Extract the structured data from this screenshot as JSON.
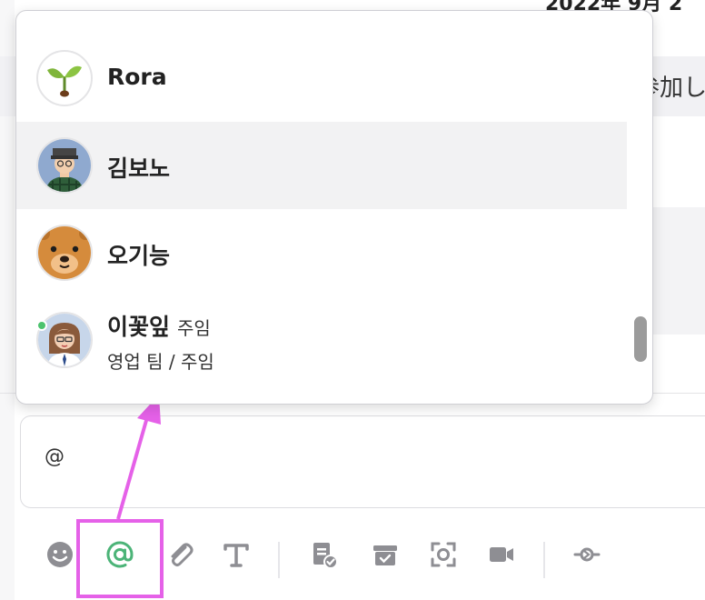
{
  "background": {
    "date_header": "2022年 9月 2",
    "band_text": "参加し",
    "accent_color": "#e561e8"
  },
  "mention_list": {
    "items": [
      {
        "name": "Rora",
        "title": "",
        "sub": "",
        "avatar": "sprout-avatar"
      },
      {
        "name": "김보노",
        "title": "",
        "sub": "",
        "avatar": "man-cap-avatar"
      },
      {
        "name": "오기능",
        "title": "",
        "sub": "",
        "avatar": "bear-avatar"
      },
      {
        "name": "이꽃잎",
        "title": "주임",
        "sub": "영업 팀 / 주임",
        "avatar": "woman-glasses-avatar",
        "online": true
      }
    ],
    "selected_index": 1
  },
  "composer": {
    "value": "@"
  },
  "toolbar": {
    "icons": [
      "emoji-icon",
      "mention-icon",
      "attach-icon",
      "text-format-icon",
      "task-icon",
      "archive-icon",
      "capture-icon",
      "video-icon",
      "commit-icon"
    ],
    "mention_color": "#4cb478"
  }
}
